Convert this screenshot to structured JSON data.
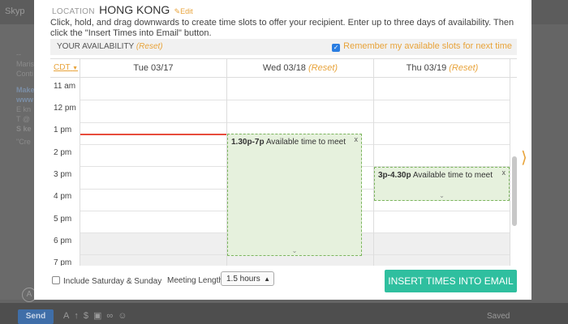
{
  "background": {
    "tab_text": "Skyp",
    "left_lines": [
      "--",
      "Maris",
      "Conti",
      "Make",
      "www",
      "E kn",
      "T @",
      "S ke",
      "\"Cre"
    ],
    "send_label": "Send",
    "saved_label": "Saved",
    "circle_letter": "A"
  },
  "location": {
    "label": "LOCATION",
    "city": "HONG KONG",
    "edit": "Edit"
  },
  "instructions": "Click, hold, and drag downwards to create time slots to offer your recipient. Enter up to three days of availability. Then click the \"Insert Times into Email\" button.",
  "availability": {
    "title": "YOUR AVAILABILITY",
    "reset": "(Reset)",
    "remember_label": "Remember my available slots for next time",
    "remember_checked": true
  },
  "calendar": {
    "timezone": "CDT",
    "days": [
      {
        "label": "Tue 03/17",
        "reset": ""
      },
      {
        "label": "Wed 03/18",
        "reset": "(Reset)"
      },
      {
        "label": "Thu 03/19",
        "reset": "(Reset)"
      }
    ],
    "hours": [
      "11 am",
      "12 pm",
      "1 pm",
      "2 pm",
      "3 pm",
      "4 pm",
      "5 pm",
      "6 pm",
      "7 pm"
    ],
    "slots": [
      {
        "time": "1.30p-7p",
        "text": "Available time to meet",
        "close": "x"
      },
      {
        "time": "3p-4.30p",
        "text": "Available time to meet",
        "close": "x"
      }
    ]
  },
  "footer": {
    "weekend_label": "Include Saturday & Sunday",
    "meeting_length_label": "Meeting Length:",
    "meeting_length_value": "1.5 hours",
    "insert_button": "INSERT TIMES INTO EMAIL"
  },
  "colors": {
    "accent": "#e8a33a",
    "insert": "#2fbf9f",
    "slot_fill": "#e6f1dd",
    "now_line": "#e74c3c"
  }
}
